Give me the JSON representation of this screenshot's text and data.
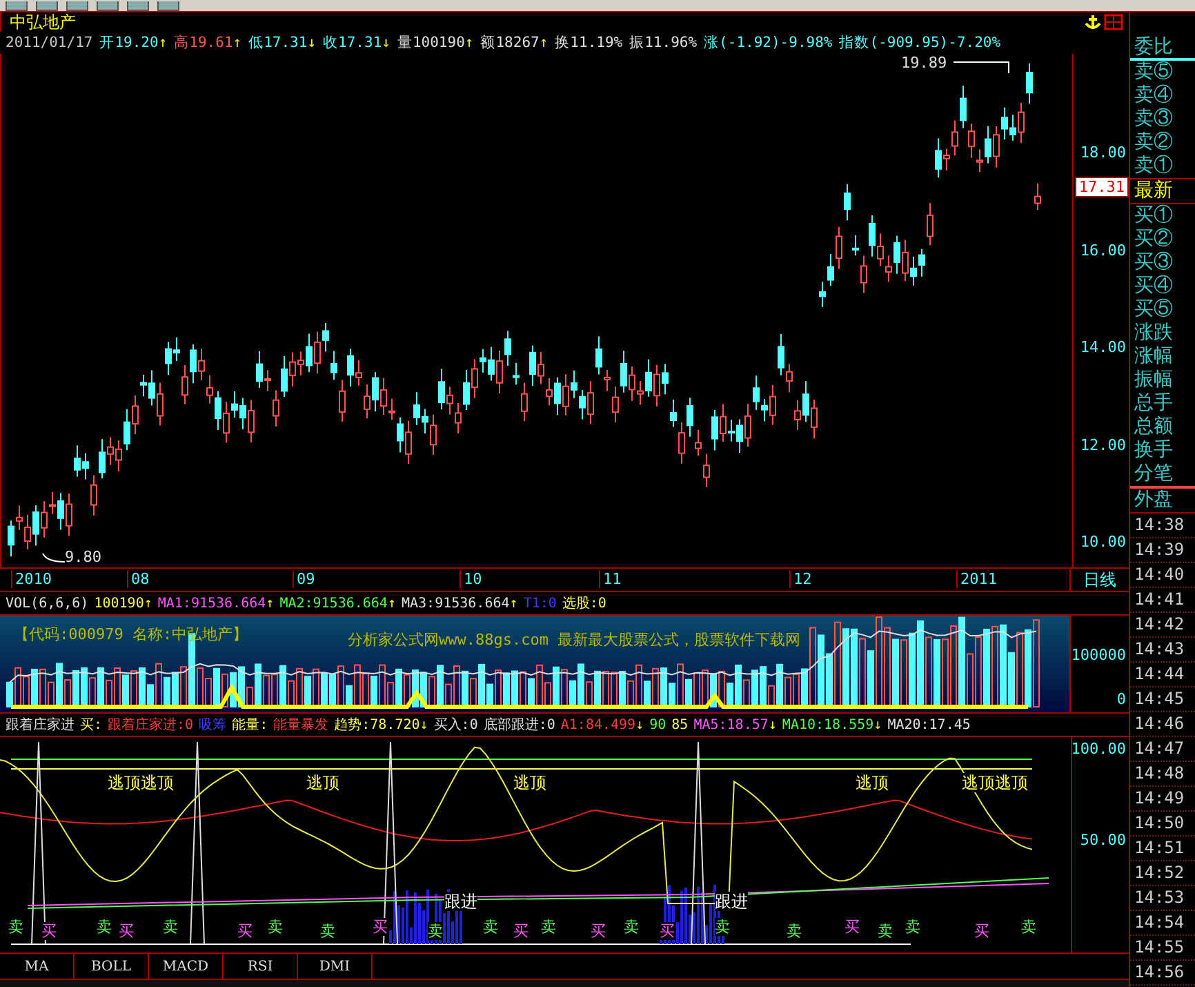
{
  "title": "中弘地产",
  "info_line": [
    {
      "text": "2011/01/17",
      "color": "#c8c8c8"
    },
    {
      "text": "开19.20",
      "color": "#54fcfc",
      "arrow": "↑"
    },
    {
      "text": "高19.61",
      "color": "#ff5454",
      "arrow": "↑"
    },
    {
      "text": "低17.31",
      "color": "#54fcfc",
      "arrow": "↓"
    },
    {
      "text": "收17.31",
      "color": "#54fcfc",
      "arrow": "↓"
    },
    {
      "text": "量100190",
      "color": "#e0e0e0",
      "arrow": "↑"
    },
    {
      "text": "额18267",
      "color": "#e0e0e0",
      "arrow": "↑"
    },
    {
      "text": "换11.19%",
      "color": "#e0e0e0"
    },
    {
      "text": "振11.96%",
      "color": "#e0e0e0"
    },
    {
      "text": "涨(-1.92)-9.98%",
      "color": "#54fcfc"
    },
    {
      "text": "指数(-909.95)-7.20%",
      "color": "#54fcfc"
    }
  ],
  "price_chart": {
    "high_label": "19.89",
    "low_label": "9.80",
    "current_price": "17.31",
    "y_labels": [
      "18.00",
      "16.00",
      "14.00",
      "12.00",
      "10.00"
    ]
  },
  "date_axis": {
    "labels": [
      "2010",
      "08",
      "09",
      "10",
      "11",
      "12",
      "2011"
    ],
    "period": "日线"
  },
  "volume_header": [
    {
      "text": "VOL(6,6,6)",
      "color": "#e0e0e0"
    },
    {
      "text": "100190",
      "color": "#fcfc54",
      "arrow": "↑"
    },
    {
      "text": "MA1:91536.664",
      "color": "#ff54ff",
      "arrow": "↑"
    },
    {
      "text": "MA2:91536.664",
      "color": "#54fc54",
      "arrow": "↑"
    },
    {
      "text": "MA3:91536.664",
      "color": "#e0e0e0",
      "arrow": "↑"
    },
    {
      "text": "T1:0",
      "color": "#3c3cff"
    },
    {
      "text": "选股:0",
      "color": "#fcfc54"
    }
  ],
  "volume_panel": {
    "stock_tag": "【代码:000979 名称:中弘地产】",
    "banner": "分析家公式网www.88gs.com 最新最大股票公式，股票软件下载网",
    "y_labels": [
      "100000",
      "0"
    ]
  },
  "indicator_header": [
    {
      "text": "跟着庄家进",
      "color": "#e0e0e0"
    },
    {
      "text": "买:",
      "color": "#fcfc54"
    },
    {
      "text": "跟着庄家进:0",
      "color": "#ff3c3c"
    },
    {
      "text": "吸筹",
      "color": "#3c3cff"
    },
    {
      "text": "能量:",
      "color": "#fcfc54"
    },
    {
      "text": "能量暴发",
      "color": "#ff3c3c"
    },
    {
      "text": "趋势:78.720",
      "color": "#fcfc54",
      "arrow": "↓"
    },
    {
      "text": "买入:0",
      "color": "#e0e0e0"
    },
    {
      "text": "底部跟进:0",
      "color": "#e0e0e0"
    },
    {
      "text": "A1:84.499",
      "color": "#ff3c3c",
      "arrow": "↓"
    },
    {
      "text": "90",
      "color": "#54fc54"
    },
    {
      "text": "85",
      "color": "#fcfc54"
    },
    {
      "text": "MA5:18.57",
      "color": "#ff54ff",
      "arrow": "↓"
    },
    {
      "text": "MA10:18.559",
      "color": "#54fc54",
      "arrow": "↓"
    },
    {
      "text": "MA20:17.45",
      "color": "#e0e0e0"
    }
  ],
  "indicator_panel": {
    "y_labels": [
      "100.00",
      "50.00"
    ],
    "top_signals": [
      "逃顶逃顶",
      "逃顶",
      "逃顶",
      "逃顶",
      "逃顶逃顶"
    ],
    "follow_signals": [
      "跟进",
      "跟进"
    ],
    "trade_marks": [
      {
        "text": "卖",
        "kind": "sell"
      },
      {
        "text": "买",
        "kind": "buy"
      },
      {
        "text": "卖",
        "kind": "sell"
      },
      {
        "text": "买",
        "kind": "buy"
      },
      {
        "text": "卖",
        "kind": "sell"
      },
      {
        "text": "买",
        "kind": "buy"
      },
      {
        "text": "卖",
        "kind": "sell"
      },
      {
        "text": "卖",
        "kind": "sell"
      },
      {
        "text": "买",
        "kind": "buy"
      },
      {
        "text": "卖",
        "kind": "sell"
      },
      {
        "text": "卖",
        "kind": "sell"
      },
      {
        "text": "买",
        "kind": "buy"
      },
      {
        "text": "卖",
        "kind": "sell"
      },
      {
        "text": "买",
        "kind": "buy"
      },
      {
        "text": "卖",
        "kind": "sell"
      },
      {
        "text": "买",
        "kind": "buy"
      },
      {
        "text": "卖",
        "kind": "sell"
      },
      {
        "text": "卖",
        "kind": "sell"
      },
      {
        "text": "买",
        "kind": "buy"
      },
      {
        "text": "卖",
        "kind": "sell"
      },
      {
        "text": "卖",
        "kind": "sell"
      },
      {
        "text": "买",
        "kind": "buy"
      },
      {
        "text": "卖",
        "kind": "sell"
      }
    ]
  },
  "indicator_tabs": [
    {
      "label": "MA",
      "selected": false
    },
    {
      "label": "BOLL",
      "selected": false
    },
    {
      "label": "MACD",
      "selected": false
    },
    {
      "label": "RSI",
      "selected": false
    },
    {
      "label": "DMI",
      "selected": false
    }
  ],
  "quote_panel": [
    {
      "text": "委比",
      "kind": "header"
    },
    {
      "text": "卖⑤",
      "kind": "quote"
    },
    {
      "text": "卖④",
      "kind": "quote"
    },
    {
      "text": "卖③",
      "kind": "quote"
    },
    {
      "text": "卖②",
      "kind": "quote"
    },
    {
      "text": "卖①",
      "kind": "quote"
    },
    {
      "text": "最新",
      "kind": "latest"
    },
    {
      "text": "买①",
      "kind": "quote"
    },
    {
      "text": "买②",
      "kind": "quote"
    },
    {
      "text": "买③",
      "kind": "quote"
    },
    {
      "text": "买④",
      "kind": "quote"
    },
    {
      "text": "买⑤",
      "kind": "quote"
    },
    {
      "text": "涨跌",
      "kind": "stat"
    },
    {
      "text": "涨幅",
      "kind": "stat"
    },
    {
      "text": "振幅",
      "kind": "stat"
    },
    {
      "text": "总手",
      "kind": "stat"
    },
    {
      "text": "总额",
      "kind": "stat"
    },
    {
      "text": "换手",
      "kind": "stat"
    },
    {
      "text": "分笔",
      "kind": "stat"
    },
    {
      "text": "外盘",
      "kind": "section"
    },
    {
      "text": "14:38",
      "kind": "time"
    },
    {
      "text": "14:39",
      "kind": "time"
    },
    {
      "text": "14:40",
      "kind": "time"
    },
    {
      "text": "14:41",
      "kind": "time"
    },
    {
      "text": "14:42",
      "kind": "time"
    },
    {
      "text": "14:43",
      "kind": "time"
    },
    {
      "text": "14:44",
      "kind": "time"
    },
    {
      "text": "14:45",
      "kind": "time"
    },
    {
      "text": "14:46",
      "kind": "time"
    },
    {
      "text": "14:47",
      "kind": "time"
    },
    {
      "text": "14:48",
      "kind": "time"
    },
    {
      "text": "14:49",
      "kind": "time"
    },
    {
      "text": "14:50",
      "kind": "time"
    },
    {
      "text": "14:51",
      "kind": "time"
    },
    {
      "text": "14:52",
      "kind": "time"
    },
    {
      "text": "14:53",
      "kind": "time"
    },
    {
      "text": "14:54",
      "kind": "time"
    },
    {
      "text": "14:55",
      "kind": "time"
    },
    {
      "text": "14:56",
      "kind": "time"
    }
  ]
}
